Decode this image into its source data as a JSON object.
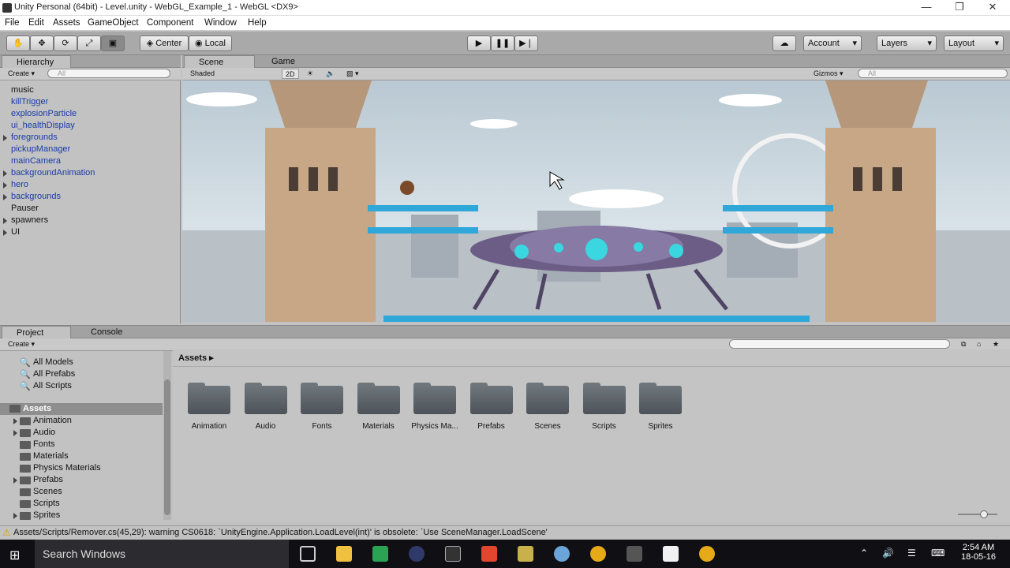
{
  "window": {
    "title": "Unity Personal (64bit) - Level.unity - WebGL_Example_1 - WebGL <DX9>",
    "min": "—",
    "max": "❐",
    "close": "✕"
  },
  "menu": [
    "File",
    "Edit",
    "Assets",
    "GameObject",
    "Component",
    "Window",
    "Help"
  ],
  "toolbar": {
    "center": "Center",
    "local": "Local",
    "account": "Account",
    "layers": "Layers",
    "layout": "Layout"
  },
  "hierarchy": {
    "tab": "Hierarchy",
    "create": "Create",
    "search_placeholder": "All",
    "items": [
      {
        "label": "music",
        "blue": false,
        "arrow": false
      },
      {
        "label": "killTrigger",
        "blue": true,
        "arrow": false
      },
      {
        "label": "explosionParticle",
        "blue": true,
        "arrow": false
      },
      {
        "label": "ui_healthDisplay",
        "blue": true,
        "arrow": false
      },
      {
        "label": "foregrounds",
        "blue": true,
        "arrow": true
      },
      {
        "label": "pickupManager",
        "blue": true,
        "arrow": false
      },
      {
        "label": "mainCamera",
        "blue": true,
        "arrow": false
      },
      {
        "label": "backgroundAnimation",
        "blue": true,
        "arrow": true
      },
      {
        "label": "hero",
        "blue": true,
        "arrow": true
      },
      {
        "label": "backgrounds",
        "blue": true,
        "arrow": true
      },
      {
        "label": "Pauser",
        "blue": false,
        "arrow": false
      },
      {
        "label": "spawners",
        "blue": false,
        "arrow": true
      },
      {
        "label": "UI",
        "blue": false,
        "arrow": true
      }
    ]
  },
  "scene": {
    "tab_scene": "Scene",
    "tab_game": "Game",
    "shading": "Shaded",
    "mode2d": "2D",
    "gizmos": "Gizmos",
    "search_placeholder": "All"
  },
  "project": {
    "tab_project": "Project",
    "tab_console": "Console",
    "create": "Create",
    "favorites": [
      "All Models",
      "All Prefabs",
      "All Scripts"
    ],
    "tree_root": "Assets",
    "tree": [
      {
        "label": "Animation",
        "arrow": true
      },
      {
        "label": "Audio",
        "arrow": true
      },
      {
        "label": "Fonts",
        "arrow": false
      },
      {
        "label": "Materials",
        "arrow": false
      },
      {
        "label": "Physics Materials",
        "arrow": false
      },
      {
        "label": "Prefabs",
        "arrow": true
      },
      {
        "label": "Scenes",
        "arrow": false
      },
      {
        "label": "Scripts",
        "arrow": false
      },
      {
        "label": "Sprites",
        "arrow": true
      }
    ],
    "breadcrumb": "Assets",
    "folders": [
      "Animation",
      "Audio",
      "Fonts",
      "Materials",
      "Physics Ma...",
      "Prefabs",
      "Scenes",
      "Scripts",
      "Sprites"
    ]
  },
  "status": {
    "message": "Assets/Scripts/Remover.cs(45,29): warning CS0618: `UnityEngine.Application.LoadLevel(int)' is obsolete: `Use SceneManager.LoadScene'"
  },
  "taskbar": {
    "search": "Search Windows",
    "time": "2:54 AM",
    "date": "18-05-16"
  }
}
